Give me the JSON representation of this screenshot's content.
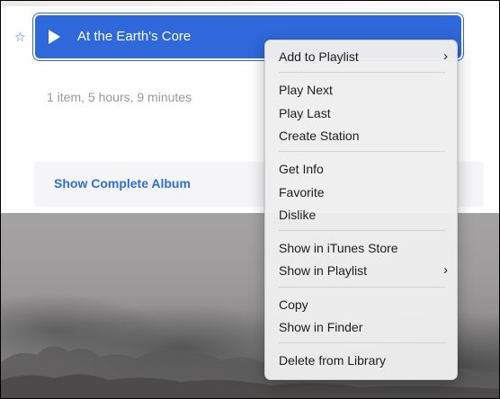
{
  "track": {
    "title": "At the Earth's Core",
    "star_icon": "star-icon"
  },
  "album": {
    "summary": "1 item, 5 hours, 9 minutes",
    "show_complete_label": "Show Complete Album"
  },
  "context_menu": {
    "groups": [
      [
        {
          "label": "Add to Playlist",
          "submenu": true
        }
      ],
      [
        {
          "label": "Play Next"
        },
        {
          "label": "Play Last"
        },
        {
          "label": "Create Station"
        }
      ],
      [
        {
          "label": "Get Info"
        },
        {
          "label": "Favorite"
        },
        {
          "label": "Dislike"
        }
      ],
      [
        {
          "label": "Show in iTunes Store"
        },
        {
          "label": "Show in Playlist",
          "submenu": true
        }
      ],
      [
        {
          "label": "Copy"
        },
        {
          "label": "Show in Finder"
        }
      ],
      [
        {
          "label": "Delete from Library"
        }
      ]
    ]
  },
  "colors": {
    "accent": "#2f68da",
    "link": "#2d6fd6"
  }
}
